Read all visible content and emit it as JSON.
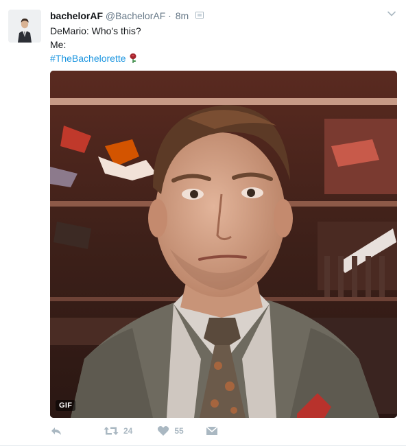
{
  "tweet": {
    "display_name": "bachelorAF",
    "handle": "@BachelorAF",
    "separator": "·",
    "time": "8m",
    "lines": [
      "DeMario: Who's this?",
      "Me:"
    ],
    "hashtag": "#TheBachelorette",
    "media_badge": "GIF",
    "retweet_count": "24",
    "like_count": "55"
  },
  "icons": {
    "caret": "chevron-down-icon",
    "reply": "reply-icon",
    "retweet": "retweet-icon",
    "like": "heart-icon",
    "dm": "direct-message-icon",
    "emoji": "rose-emoji"
  },
  "colors": {
    "text": "#14171a",
    "muted": "#657786",
    "hashtag": "#1b95e0",
    "action_icon": "#aab8c2"
  }
}
